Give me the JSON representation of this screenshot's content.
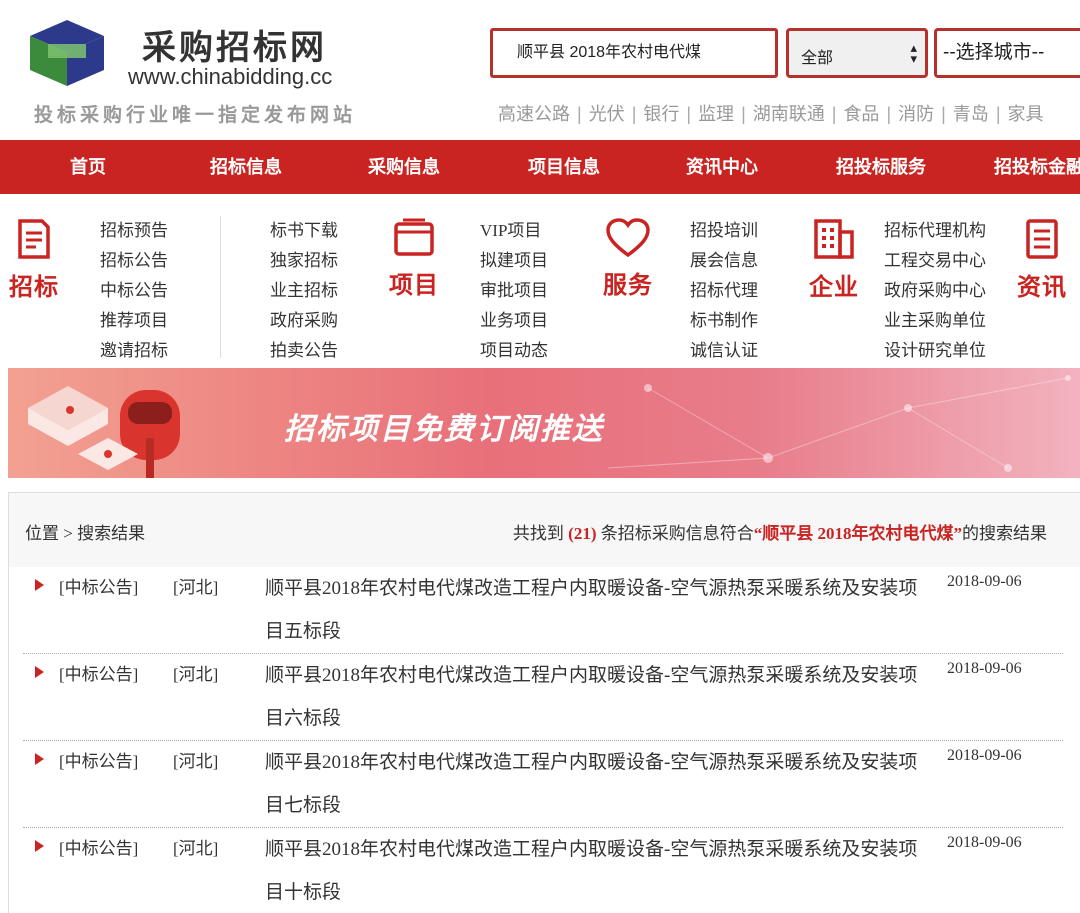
{
  "header": {
    "site_name": "采购招标网",
    "domain": "www.chinabidding.cc",
    "slogan": "投标采购行业唯一指定发布网站",
    "search_value": "顺平县 2018年农村电代煤",
    "scope_select": "全部",
    "city_select": "--选择城市--",
    "hot_links": [
      "高速公路",
      "光伏",
      "银行",
      "监理",
      "湖南联通",
      "食品",
      "消防",
      "青岛",
      "家具"
    ]
  },
  "nav": [
    "首页",
    "招标信息",
    "采购信息",
    "项目信息",
    "资讯中心",
    "招投标服务",
    "招投标金融"
  ],
  "categories": {
    "bidding": {
      "label": "招标",
      "col1": [
        "招标预告",
        "招标公告",
        "中标公告",
        "推荐项目",
        "邀请招标"
      ],
      "col2": [
        "标书下载",
        "独家招标",
        "业主招标",
        "政府采购",
        "拍卖公告"
      ]
    },
    "project": {
      "label": "项目",
      "items": [
        "VIP项目",
        "拟建项目",
        "审批项目",
        "业务项目",
        "项目动态"
      ]
    },
    "service": {
      "label": "服务",
      "items": [
        "招投培训",
        "展会信息",
        "招标代理",
        "标书制作",
        "诚信认证"
      ]
    },
    "enterprise": {
      "label": "企业",
      "items": [
        "招标代理机构",
        "工程交易中心",
        "政府采购中心",
        "业主采购单位",
        "设计研究单位"
      ]
    },
    "news": {
      "label": "资讯"
    }
  },
  "banner": {
    "text": "招标项目免费订阅推送",
    "accent_color": "#c92421"
  },
  "results": {
    "breadcrumb": "位置 > 搜索结果",
    "found_prefix": "共找到",
    "found_count": "(21)",
    "found_middle": "条招标采购信息符合",
    "found_query": "“顺平县 2018年农村电代煤”",
    "found_suffix": "的搜索结果",
    "rows": [
      {
        "type": "[中标公告]",
        "region": "[河北]",
        "title": "顺平县2018年农村电代煤改造工程户内取暖设备-空气源热泵采暖系统及安装项目五标段",
        "date": "2018-09-06"
      },
      {
        "type": "[中标公告]",
        "region": "[河北]",
        "title": "顺平县2018年农村电代煤改造工程户内取暖设备-空气源热泵采暖系统及安装项目六标段",
        "date": "2018-09-06"
      },
      {
        "type": "[中标公告]",
        "region": "[河北]",
        "title": "顺平县2018年农村电代煤改造工程户内取暖设备-空气源热泵采暖系统及安装项目七标段",
        "date": "2018-09-06"
      },
      {
        "type": "[中标公告]",
        "region": "[河北]",
        "title": "顺平县2018年农村电代煤改造工程户内取暖设备-空气源热泵采暖系统及安装项目十标段",
        "date": "2018-09-06"
      }
    ]
  }
}
